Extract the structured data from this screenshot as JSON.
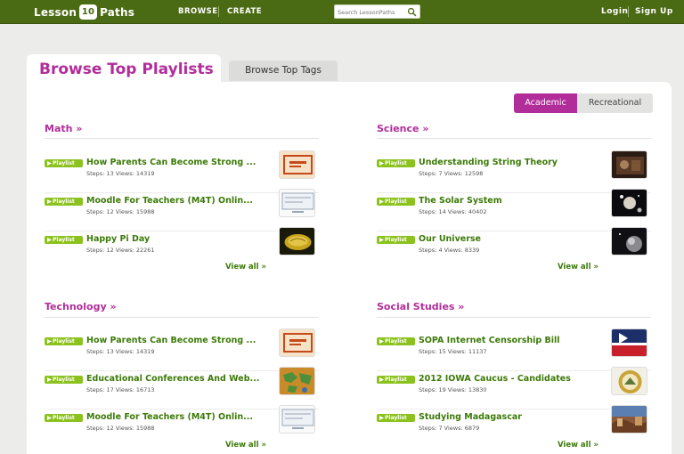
{
  "header": {
    "logo_left": "Lesson",
    "logo_mark": "10",
    "logo_right": "Paths",
    "nav_browse": "BROWSE",
    "nav_create": "CREATE",
    "search_placeholder": "Search LessonPaths",
    "login": "Login",
    "signup": "Sign Up"
  },
  "tabs": {
    "active": "Browse Top Playlists",
    "inactive": "Browse Top Tags"
  },
  "toggle": {
    "academic": "Academic",
    "recreational": "Recreational"
  },
  "badge_label": "Playlist",
  "view_all": "View all »",
  "categories": [
    {
      "title": "Math »",
      "items": [
        {
          "title": "How Parents Can Become Strong ...",
          "steps": "Steps: 13",
          "views": "Views: 14319",
          "thumb": "board"
        },
        {
          "title": "Moodle For Teachers (M4T) Onlin...",
          "steps": "Steps: 12",
          "views": "Views: 15988",
          "thumb": "screen"
        },
        {
          "title": "Happy Pi Day",
          "steps": "Steps: 12",
          "views": "Views: 22261",
          "thumb": "pie"
        }
      ]
    },
    {
      "title": "Science »",
      "items": [
        {
          "title": "Understanding String Theory",
          "steps": "Steps: 7",
          "views": "Views: 12598",
          "thumb": "dark"
        },
        {
          "title": "The Solar System",
          "steps": "Steps: 14",
          "views": "Views: 40402",
          "thumb": "space"
        },
        {
          "title": "Our Universe",
          "steps": "Steps: 4",
          "views": "Views: 8339",
          "thumb": "planet"
        }
      ]
    },
    {
      "title": "Technology »",
      "items": [
        {
          "title": "How Parents Can Become Strong ...",
          "steps": "Steps: 13",
          "views": "Views: 14319",
          "thumb": "board"
        },
        {
          "title": "Educational Conferences And Web...",
          "steps": "Steps: 17",
          "views": "Views: 16713",
          "thumb": "map"
        },
        {
          "title": "Moodle For Teachers (M4T) Onlin...",
          "steps": "Steps: 12",
          "views": "Views: 15988",
          "thumb": "screen"
        }
      ]
    },
    {
      "title": "Social Studies »",
      "items": [
        {
          "title": "SOPA Internet Censorship Bill",
          "steps": "Steps: 15",
          "views": "Views: 11137",
          "thumb": "flag"
        },
        {
          "title": "2012 IOWA Caucus - Candidates",
          "steps": "Steps: 19",
          "views": "Views: 13830",
          "thumb": "seal"
        },
        {
          "title": "Studying Madagascar",
          "steps": "Steps: 7",
          "views": "Views: 6879",
          "thumb": "photo"
        }
      ]
    }
  ]
}
